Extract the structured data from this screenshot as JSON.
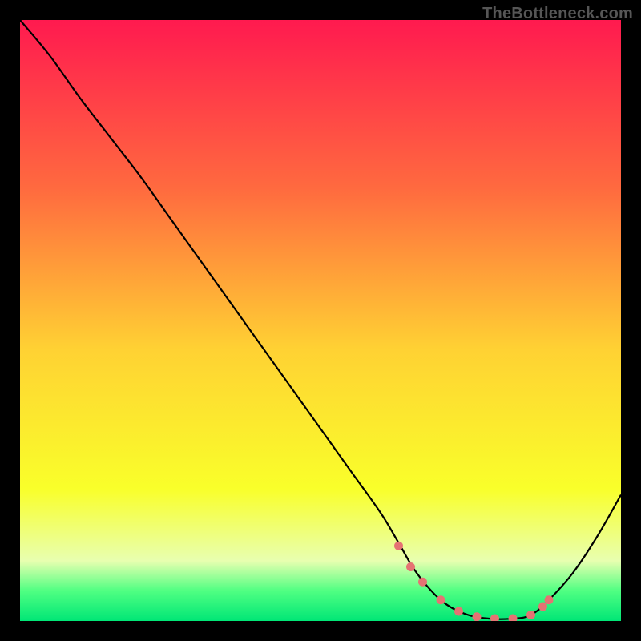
{
  "watermark": "TheBottleneck.com",
  "colors": {
    "bg_top": "#ff1a4f",
    "bg_upper": "#ff6a3f",
    "bg_mid": "#ffd233",
    "bg_lower": "#f9ff2a",
    "bg_pale": "#e8ffb0",
    "bg_green1": "#4fff82",
    "bg_green2": "#00e676",
    "curve": "#000000",
    "markers": "#e57373"
  },
  "chart_data": {
    "type": "line",
    "title": "",
    "xlabel": "",
    "ylabel": "",
    "xlim": [
      0,
      100
    ],
    "ylim": [
      0,
      100
    ],
    "series": [
      {
        "name": "bottleneck-curve",
        "x": [
          0,
          5,
          10,
          15,
          20,
          25,
          30,
          35,
          40,
          45,
          50,
          55,
          60,
          63,
          66,
          70,
          74,
          78,
          82,
          85,
          88,
          92,
          96,
          100
        ],
        "values": [
          100,
          94,
          87,
          80.5,
          74,
          67,
          60,
          53,
          46,
          39,
          32,
          25,
          18,
          13,
          8,
          3.5,
          1.2,
          0.4,
          0.4,
          1.0,
          3.5,
          8,
          14,
          21
        ]
      }
    ],
    "markers": {
      "name": "highlight-points",
      "x": [
        63,
        65,
        67,
        70,
        73,
        76,
        79,
        82,
        85,
        87,
        88
      ],
      "values": [
        12.5,
        9,
        6.5,
        3.5,
        1.6,
        0.7,
        0.4,
        0.4,
        1.0,
        2.4,
        3.5
      ]
    },
    "gradient_stops": [
      {
        "offset": 0.0,
        "key": "bg_top"
      },
      {
        "offset": 0.28,
        "key": "bg_upper"
      },
      {
        "offset": 0.55,
        "key": "bg_mid"
      },
      {
        "offset": 0.78,
        "key": "bg_lower"
      },
      {
        "offset": 0.9,
        "key": "bg_pale"
      },
      {
        "offset": 0.95,
        "key": "bg_green1"
      },
      {
        "offset": 1.0,
        "key": "bg_green2"
      }
    ]
  }
}
